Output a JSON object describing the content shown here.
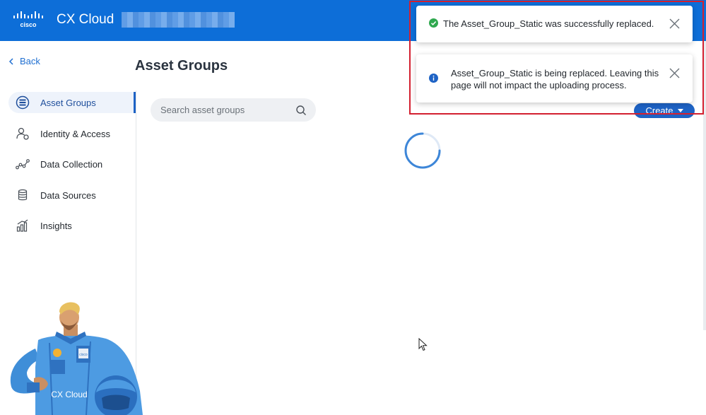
{
  "header": {
    "logo_text": "cisco",
    "app_title": "CX Cloud"
  },
  "sidebar": {
    "back_label": "Back",
    "items": [
      {
        "label": "Asset Groups",
        "icon": "asset-groups-icon",
        "active": true
      },
      {
        "label": "Identity & Access",
        "icon": "identity-icon",
        "active": false
      },
      {
        "label": "Data Collection",
        "icon": "data-collection-icon",
        "active": false
      },
      {
        "label": "Data Sources",
        "icon": "database-icon",
        "active": false
      },
      {
        "label": "Insights",
        "icon": "insights-icon",
        "active": false
      }
    ]
  },
  "main": {
    "page_title": "Asset Groups",
    "search_placeholder": "Search asset groups",
    "create_label": "Create"
  },
  "toasts": [
    {
      "type": "success",
      "message": "The Asset_Group_Static was successfully replaced."
    },
    {
      "type": "info",
      "message": "Asset_Group_Static is being replaced. Leaving this page will not impact the uploading process."
    }
  ],
  "mascot": {
    "badge_text": "CX Cloud",
    "chest_logo": "cisco"
  },
  "colors": {
    "header_bg": "#0d6ed8",
    "accent": "#1e63c5",
    "success": "#2fa84f",
    "info": "#1e63c5",
    "highlight": "#d32030"
  }
}
